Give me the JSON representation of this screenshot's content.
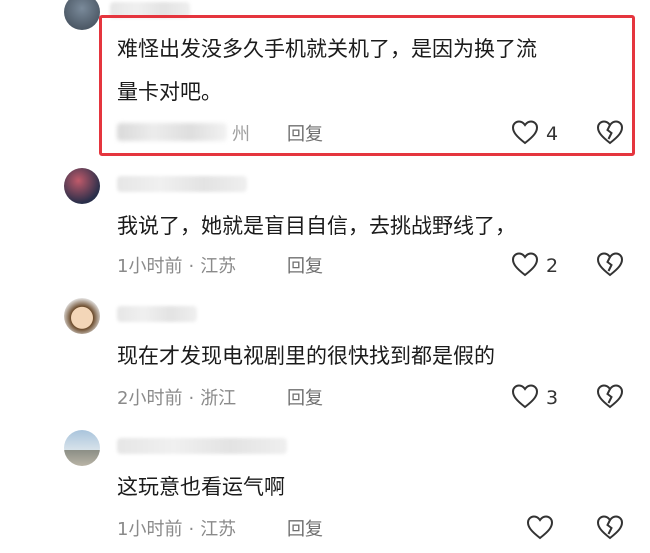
{
  "comments": [
    {
      "text_lines": [
        "难怪出发没多久手机就关机了，是因为换了流",
        "量卡对吧。"
      ],
      "location_fragment": "州",
      "reply": "回复",
      "likes": "4"
    },
    {
      "text_lines": [
        "我说了，她就是盲目自信，去挑战野线了，"
      ],
      "time": "1小时前",
      "location": "江苏",
      "reply": "回复",
      "likes": "2"
    },
    {
      "text_lines": [
        "现在才发现电视剧里的很快找到都是假的"
      ],
      "time": "2小时前",
      "location": "浙江",
      "reply": "回复",
      "likes": "3"
    },
    {
      "text_lines": [
        "这玩意也看运气啊"
      ],
      "time": "1小时前",
      "location": "江苏",
      "reply": "回复",
      "likes": ""
    }
  ],
  "colors": {
    "highlight": "#e5353e",
    "meta": "#8a8a8a"
  },
  "icons": {
    "like": "heart-outline-icon",
    "dislike": "broken-heart-icon"
  }
}
